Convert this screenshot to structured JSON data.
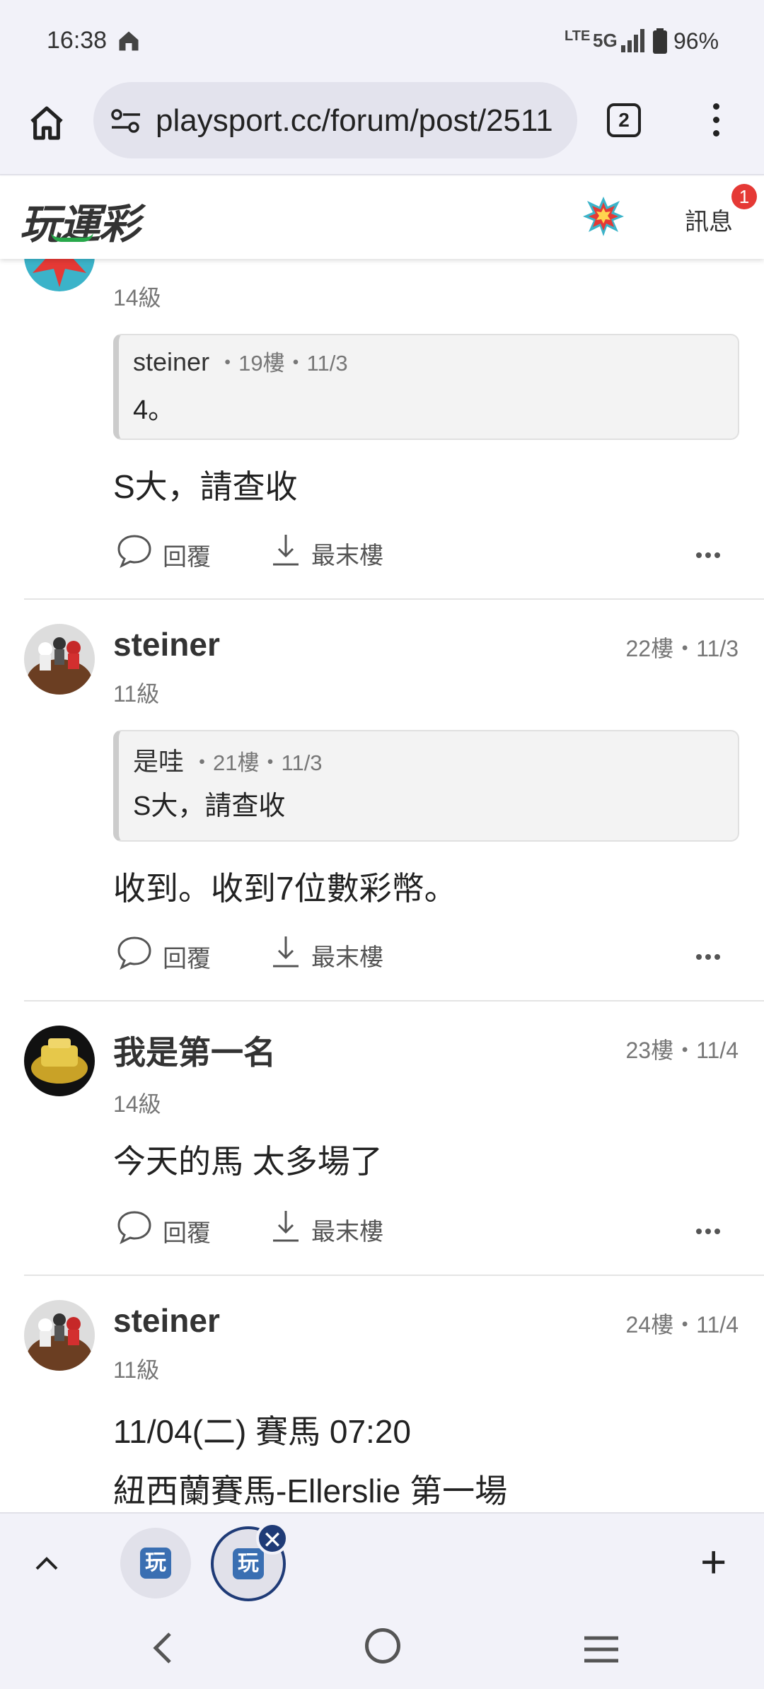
{
  "status_bar": {
    "time": "16:38",
    "network": "LTE",
    "signal_type": "5G",
    "battery": "96%"
  },
  "browser": {
    "url": "playsport.cc/forum/post/2511",
    "tab_count": "2"
  },
  "site_header": {
    "logo": "玩運彩",
    "messages_label": "訊息",
    "messages_badge": "1"
  },
  "posts": [
    {
      "level": "14級",
      "quote": {
        "author": "steiner",
        "meta": "・19樓・11/3",
        "text": "4。"
      },
      "body": "S大，請查收",
      "reply_label": "回覆",
      "last_floor_label": "最末樓"
    },
    {
      "username": "steiner",
      "meta": "22樓・11/3",
      "level": "11級",
      "quote": {
        "author": "是哇",
        "meta": "・21樓・11/3",
        "text": "S大，請查收"
      },
      "body": "收到。收到7位數彩幣。",
      "reply_label": "回覆",
      "last_floor_label": "最末樓"
    },
    {
      "username": "我是第一名",
      "meta": "23樓・11/4",
      "level": "14級",
      "body": "今天的馬 太多場了",
      "reply_label": "回覆",
      "last_floor_label": "最末樓"
    },
    {
      "username": "steiner",
      "meta": "24樓・11/4",
      "level": "11級",
      "body_lines": [
        "11/04(二) 賽馬 07:20",
        "紐西蘭賽馬-Ellerslie 第一場"
      ]
    }
  ],
  "tab_bar": {
    "favicon_text": "玩",
    "close_symbol": "✕",
    "new_tab_symbol": "+"
  },
  "colors": {
    "badge": "#e53935",
    "logo_check": "#27a84a",
    "active_tab": "#1f3b77"
  }
}
